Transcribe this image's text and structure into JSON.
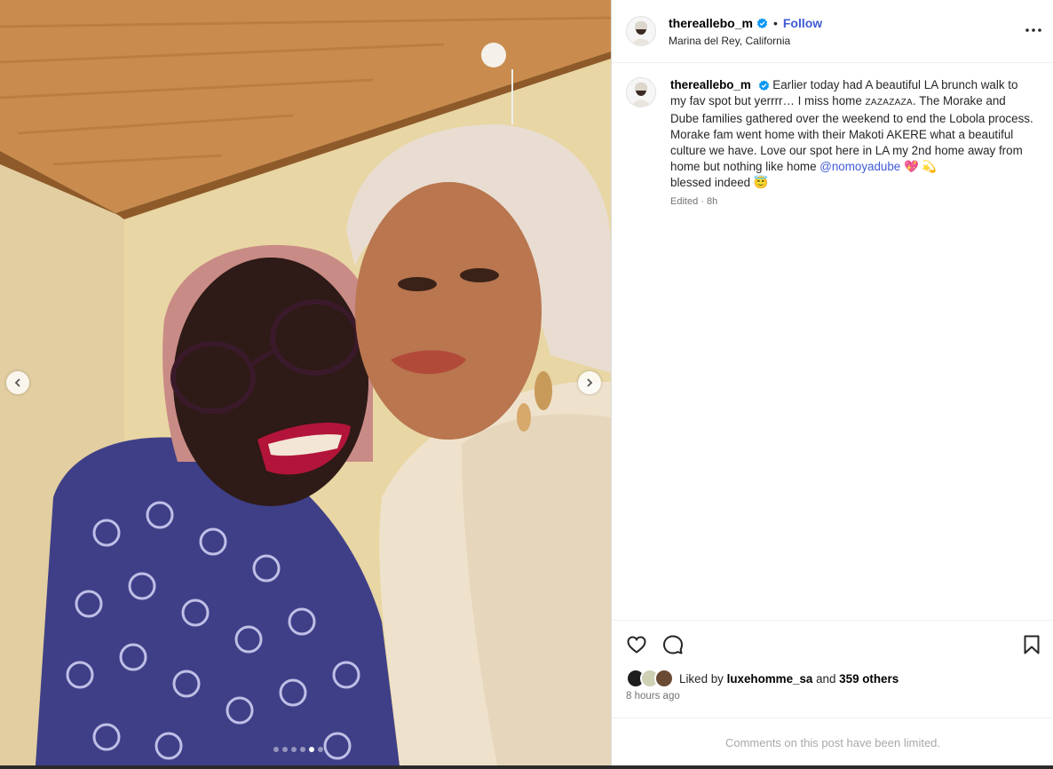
{
  "post": {
    "username": "thereallebo_m",
    "follow_label": "Follow",
    "separator": "•",
    "location": "Marina del Rey, California",
    "caption_intro": "Earlier today had A beautiful LA brunch walk to my fav spot but yerrrr… I miss home ",
    "caption_small": "ZAZAZAZA",
    "caption_mid": ". The Morake and Dube families gathered over the weekend to end the Lobola process. Morake fam went home with their Makoti AKERE what a beautiful culture we have. Love our spot here in LA my 2nd home away from home but nothing like home ",
    "mention": "@nomoyadube",
    "caption_emojis": " 💖 💫",
    "caption_end": "blessed indeed 😇",
    "meta": "Edited · 8h",
    "liked_by_prefix": "Liked by ",
    "liked_by_user": "luxehomme_sa",
    "liked_by_and": " and ",
    "liked_by_others": "359 others",
    "time_ago": "8 hours ago",
    "comments_limited": "Comments on this post have been limited."
  },
  "carousel": {
    "slide_count": 6,
    "active_index": 4
  },
  "icons": {
    "verified": "verified-badge-icon",
    "more": "more-options-icon",
    "like": "heart-icon",
    "comment": "comment-icon",
    "save": "bookmark-icon",
    "prev": "chevron-left-icon",
    "next": "chevron-right-icon"
  },
  "colors": {
    "link": "#3f5bd8",
    "verified": "#0095f6",
    "muted": "#737373"
  }
}
